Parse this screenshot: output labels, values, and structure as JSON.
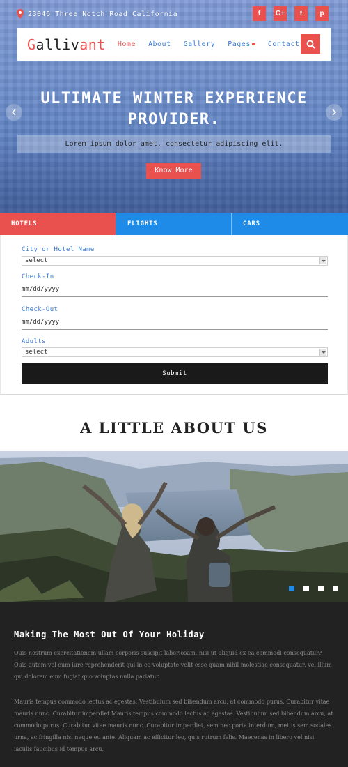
{
  "topbar": {
    "address": "23046 Three Notch Road California",
    "socials": [
      {
        "icon": "facebook-icon",
        "glyph": "f"
      },
      {
        "icon": "google-plus-icon",
        "glyph": "G+"
      },
      {
        "icon": "twitter-icon",
        "glyph": "t"
      },
      {
        "icon": "pinterest-icon",
        "glyph": "p"
      }
    ]
  },
  "navbar": {
    "logo_first": "G",
    "logo_mid": "alliv",
    "logo_last": "ant",
    "items": [
      "Home",
      "About",
      "Gallery",
      "Pages",
      "Contact"
    ],
    "active": "Home"
  },
  "hero": {
    "title_line1": "ULTIMATE WINTER EXPERIENCE",
    "title_line2": "PROVIDER.",
    "subtitle": "Lorem ipsum dolor amet, consectetur adipiscing elit.",
    "button": "Know More"
  },
  "booking": {
    "tabs": [
      "HOTELS",
      "FLIGHTS",
      "CARS"
    ],
    "active_tab": "HOTELS",
    "city_label": "City or Hotel Name",
    "city_value": "select",
    "checkin_label": "Check-In",
    "checkin_value": "mm/dd/yyyy",
    "checkout_label": "Check-Out",
    "checkout_value": "mm/dd/yyyy",
    "adults_label": "Adults",
    "adults_value": "select",
    "submit": "Submit"
  },
  "about": {
    "title": "A LITTLE ABOUT US",
    "slides": 4,
    "active_slide": 1,
    "heading": "Making The Most Out Of Your Holiday",
    "para1": "Quis nostrum exercitationem ullam corporis suscipit laboriosam, nisi ut aliquid ex ea commodi consequatur? Quis autem vel eum iure reprehenderit qui in ea voluptate velit esse quam nihil molestiae consequatur, vel illum qui dolorem eum fugiat quo voluptas nulla pariatur.",
    "para2": "Mauris tempus commodo lectus ac egestas. Vestibulum sed bibendum arcu, at commodo purus. Curabitur vitae mauris nunc. Curabitur imperdiet.Mauris tempus commodo lectus ac egestas. Vestibulum sed bibendum arcu, at commodo purus. Curabitur vitae mauris nunc. Curabitur imperdiet, sem nec porta interdum, metus sem sodales urna, ac fringilla nisl neque eu ante. Aliquam ac efficitur leo, quis rutrum felis. Maecenas in libero vel nisi iaculis faucibus id tempus arcu."
  },
  "colors": {
    "accent_red": "#e9514f",
    "accent_blue": "#1e8be8",
    "dark_section": "#222222"
  }
}
